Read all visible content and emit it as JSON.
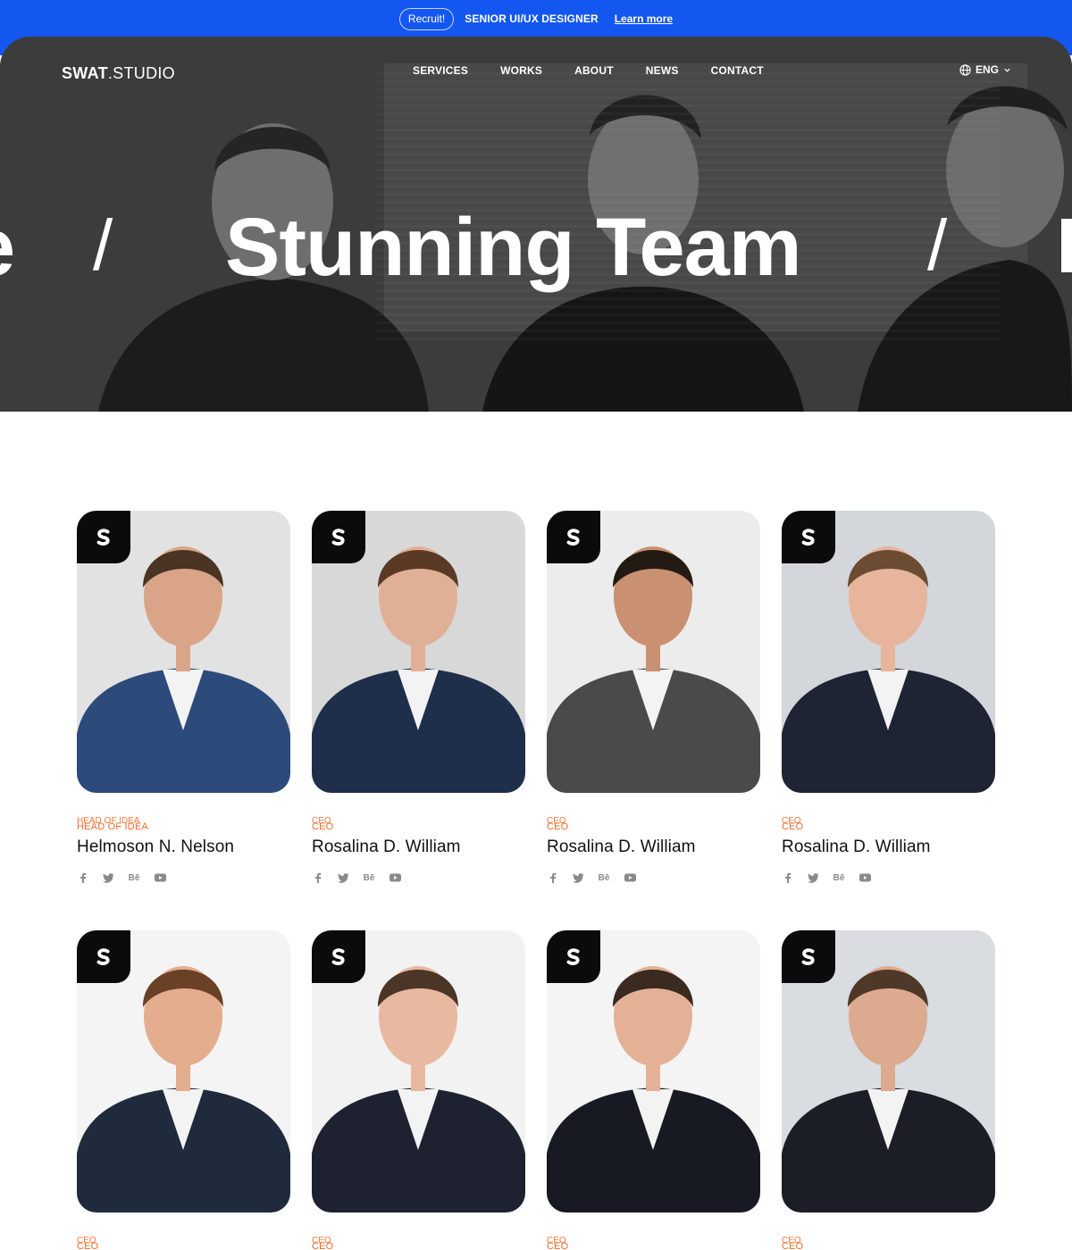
{
  "topbar": {
    "pill": "Recruit!",
    "text": "SENIOR UI/UX DESIGNER",
    "link": "Learn more"
  },
  "nav": {
    "logo_bold": "SWAT",
    "logo_light": ".STUDIO",
    "items": [
      "SERVICES",
      "WORKS",
      "ABOUT",
      "NEWS",
      "CONTACT"
    ],
    "lang": "ENG"
  },
  "hero": {
    "prev_fragment": "e",
    "separator": "/",
    "title": "Stunning Team"
  },
  "team": [
    {
      "role": "HEAD OF IDEA",
      "name": "Helmoson N. Nelson",
      "suit": "#2c4a7a",
      "bg": "#e2e2e2",
      "skin": "#d9a487",
      "hair": "#4a3424"
    },
    {
      "role": "CEO",
      "name": "Rosalina D. William",
      "suit": "#1f2e4a",
      "bg": "#d8d8d8",
      "skin": "#e0b096",
      "hair": "#5a3a24"
    },
    {
      "role": "CEO",
      "name": "Rosalina D. William",
      "suit": "#4a4a4a",
      "bg": "#ececec",
      "skin": "#c99072",
      "hair": "#231a14"
    },
    {
      "role": "CEO",
      "name": "Rosalina D. William",
      "suit": "#1e2433",
      "bg": "#d3d6da",
      "skin": "#e6b59c",
      "hair": "#6b4c33"
    },
    {
      "role": "CEO",
      "name": "",
      "suit": "#1f2a3c",
      "bg": "#f4f4f4",
      "skin": "#e3ad8e",
      "hair": "#6a4026"
    },
    {
      "role": "CEO",
      "name": "",
      "suit": "#1e2230",
      "bg": "#f2f2f2",
      "skin": "#e8b8a0",
      "hair": "#4b3526"
    },
    {
      "role": "CEO",
      "name": "",
      "suit": "#171a22",
      "bg": "#f4f4f4",
      "skin": "#e4b197",
      "hair": "#3a2a20"
    },
    {
      "role": "CEO",
      "name": "",
      "suit": "#1b1e27",
      "bg": "#d9dde2",
      "skin": "#dcaa8f",
      "hair": "#4e3828"
    }
  ],
  "social_icons": [
    "facebook-icon",
    "twitter-icon",
    "behance-icon",
    "youtube-icon"
  ]
}
